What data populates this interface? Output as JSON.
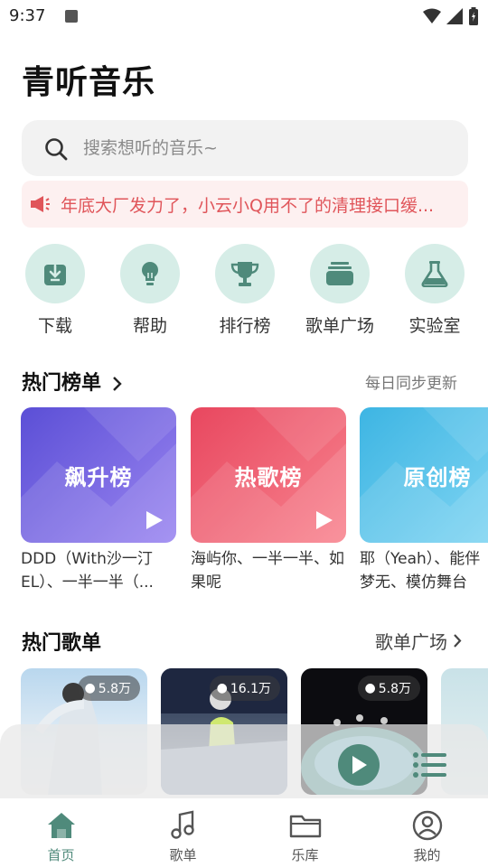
{
  "status_bar": {
    "time": "9:37"
  },
  "app": {
    "title": "青听音乐"
  },
  "search": {
    "placeholder": "搜索想听的音乐~",
    "icon": "search-icon"
  },
  "notice": {
    "text": "年底大厂发力了，小云小Q用不了的清理接口缓...",
    "icon": "megaphone-icon"
  },
  "quick_entries": [
    {
      "label": "下载",
      "icon": "download-icon"
    },
    {
      "label": "帮助",
      "icon": "lightbulb-icon"
    },
    {
      "label": "排行榜",
      "icon": "trophy-icon"
    },
    {
      "label": "歌单广场",
      "icon": "album-stack-icon"
    },
    {
      "label": "实验室",
      "icon": "flask-icon"
    }
  ],
  "hot_charts": {
    "title": "热门榜单",
    "subtitle": "每日同步更新",
    "cards": [
      {
        "title": "飙升榜",
        "desc": "DDD（With沙一汀EL）、一半一半（...",
        "color_from": "#5b4fd6",
        "color_to": "#9a85f0"
      },
      {
        "title": "热歌榜",
        "desc": "海屿你、一半一半、如果呢",
        "color_from": "#e8475f",
        "color_to": "#f8848f"
      },
      {
        "title": "原创榜",
        "desc": "耶（Yeah）、能伴梦无、模仿舞台",
        "color_from": "#3db5e3",
        "color_to": "#7ed4f2"
      }
    ]
  },
  "hot_playlists": {
    "title": "热门歌单",
    "link": "歌单广场",
    "cards": [
      {
        "plays": "5.8万"
      },
      {
        "plays": "16.1万"
      },
      {
        "plays": "5.8万"
      }
    ]
  },
  "bottom_nav": [
    {
      "label": "首页",
      "icon": "home-icon",
      "active": true
    },
    {
      "label": "歌单",
      "icon": "music-note-icon",
      "active": false
    },
    {
      "label": "乐库",
      "icon": "folder-icon",
      "active": false
    },
    {
      "label": "我的",
      "icon": "user-icon",
      "active": false
    }
  ],
  "colors": {
    "accent": "#4f8a7b",
    "icon_bg": "#d6ede7",
    "notice_text": "#e0555a",
    "notice_bg": "#fdf0f0"
  }
}
